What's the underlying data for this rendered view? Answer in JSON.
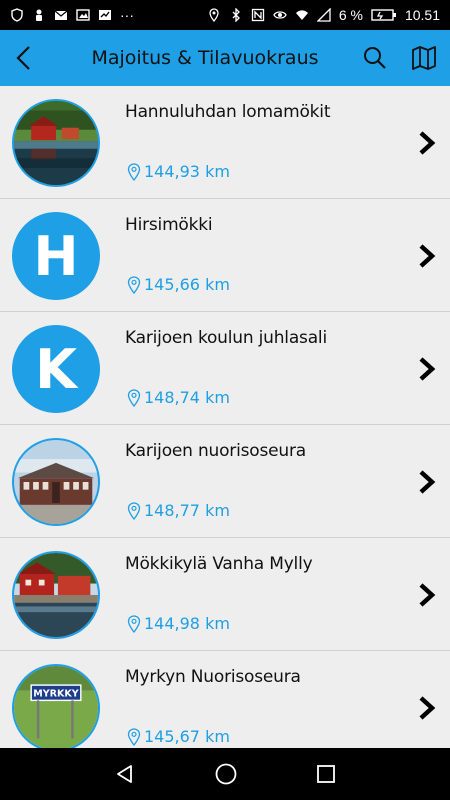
{
  "status_bar": {
    "battery_percent": "6 %",
    "time": "10.51"
  },
  "app_bar": {
    "title": "Majoitus & Tilavuokraus",
    "icons": [
      "back-arrow-icon",
      "search-icon",
      "map-icon"
    ]
  },
  "list": {
    "items": [
      {
        "title": "Hannuluhdan lomamökit",
        "distance": "144,93 km",
        "thumb": "photo-cabin-lake"
      },
      {
        "title": "Hirsimökki",
        "distance": "145,66 km",
        "thumb_letter": "H"
      },
      {
        "title": "Karijoen koulun juhlasali",
        "distance": "148,74 km",
        "thumb_letter": "K"
      },
      {
        "title": "Karijoen nuorisoseura",
        "distance": "148,77 km",
        "thumb": "photo-hall-building"
      },
      {
        "title": "Mökkikylä Vanha Mylly",
        "distance": "144,98 km",
        "thumb": "photo-red-mill"
      },
      {
        "title": "Myrkyn Nuorisoseura",
        "distance": "145,67 km",
        "thumb": "photo-village-sign",
        "thumb_sign_text": "MYRKKY"
      }
    ]
  },
  "colors": {
    "accent": "#1e9fe6",
    "list_bg": "#eeeeee",
    "divider": "#d0d0d0"
  }
}
